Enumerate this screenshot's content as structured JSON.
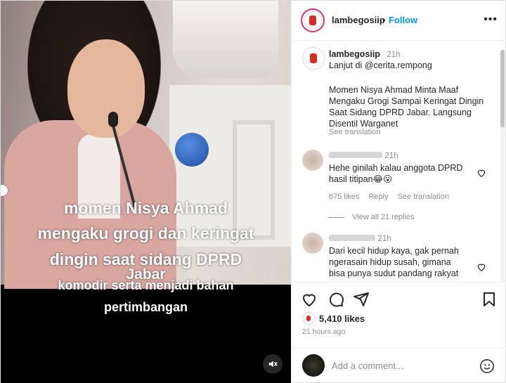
{
  "media": {
    "captions": [
      "momen Nisya Ahmad",
      "mengaku grogi dan keringat",
      "dingin saat sidang DPRD",
      "Jabar",
      "komodir serta menjadi bahan",
      "pertimbangan"
    ]
  },
  "header": {
    "username": "lambegosiip",
    "separator": "•",
    "follow_label": "Follow",
    "more_label": "•••"
  },
  "post": {
    "username": "lambegosiip",
    "time": "21h",
    "line1": "Lanjut di @cerita.rempong",
    "caption": "Momen Nisya Ahmad Minta Maaf Mengaku Grogi Sampai Keringat Dingin Saat Sidang DPRD Jabar. Langsung Disentil Warganet",
    "see_translation": "See translation"
  },
  "comments": [
    {
      "time": "21h",
      "text": "Hehe ginilah kalau anggota DPRD hasil titipan😂😮",
      "likes": "675 likes",
      "reply": "Reply",
      "see_translation": "See translation",
      "view_replies": "View all 21 replies"
    },
    {
      "time": "21h",
      "text": "Dari kecil hidup kaya, gak pernah ngerasain hidup susah, gimana bisa punya sudut pandang rakyat"
    }
  ],
  "footer": {
    "likes": "5,410 likes",
    "time": "21 hours ago",
    "add_comment_placeholder": "Add a comment..."
  },
  "colors": {
    "accent": "#0095f6",
    "border": "#dbdbdb",
    "text": "#262626",
    "muted": "#8e8e8e"
  }
}
